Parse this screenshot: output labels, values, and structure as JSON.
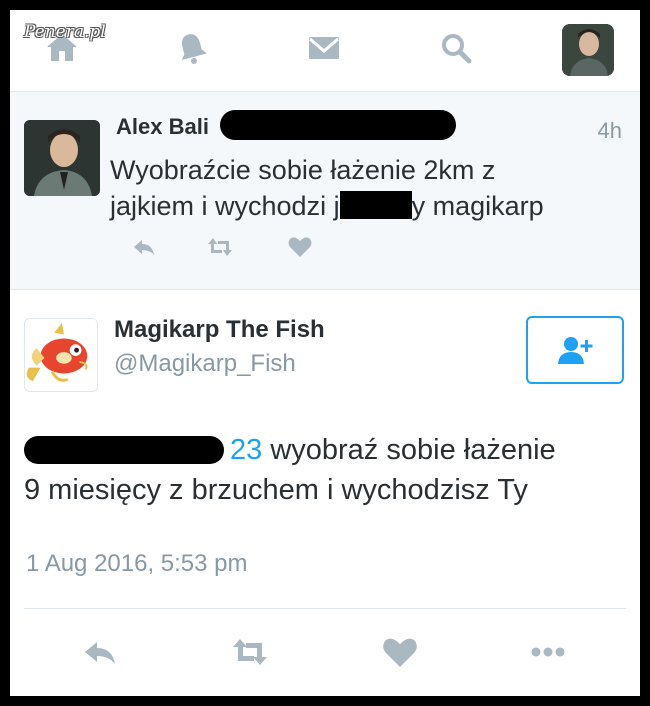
{
  "watermark": "Penera.pl",
  "nav": {
    "icons": [
      "home-icon",
      "bell-icon",
      "mail-icon",
      "search-icon"
    ],
    "avatar": "profile-avatar"
  },
  "colors": {
    "accent": "#1da1f2",
    "icon_gray": "#aab8c2",
    "text_dark": "#292f33",
    "text_muted": "#8899a6",
    "tweet_bg": "#f5f8fa"
  },
  "tweet1": {
    "name_visible": "Alex Bali",
    "time": "4h",
    "text_line1": "Wyobraźcie sobie łażenie 2km z",
    "text_line2_start": "jajkiem i wychodzi j",
    "text_line2_end": "y magikarp",
    "actions": [
      "reply-icon",
      "retweet-icon",
      "like-icon"
    ]
  },
  "tweet2": {
    "name": "Magikarp The Fish",
    "handle": "@Magikarp_Fish",
    "mention_visible": "23",
    "text_line1_rest": " wyobraź sobie łażenie",
    "text_line2": "9 miesięcy z brzuchem i wychodzisz Ty",
    "date": "1 Aug 2016, 5:53 pm",
    "actions": [
      "reply-icon",
      "retweet-icon",
      "like-icon",
      "more-icon"
    ]
  }
}
